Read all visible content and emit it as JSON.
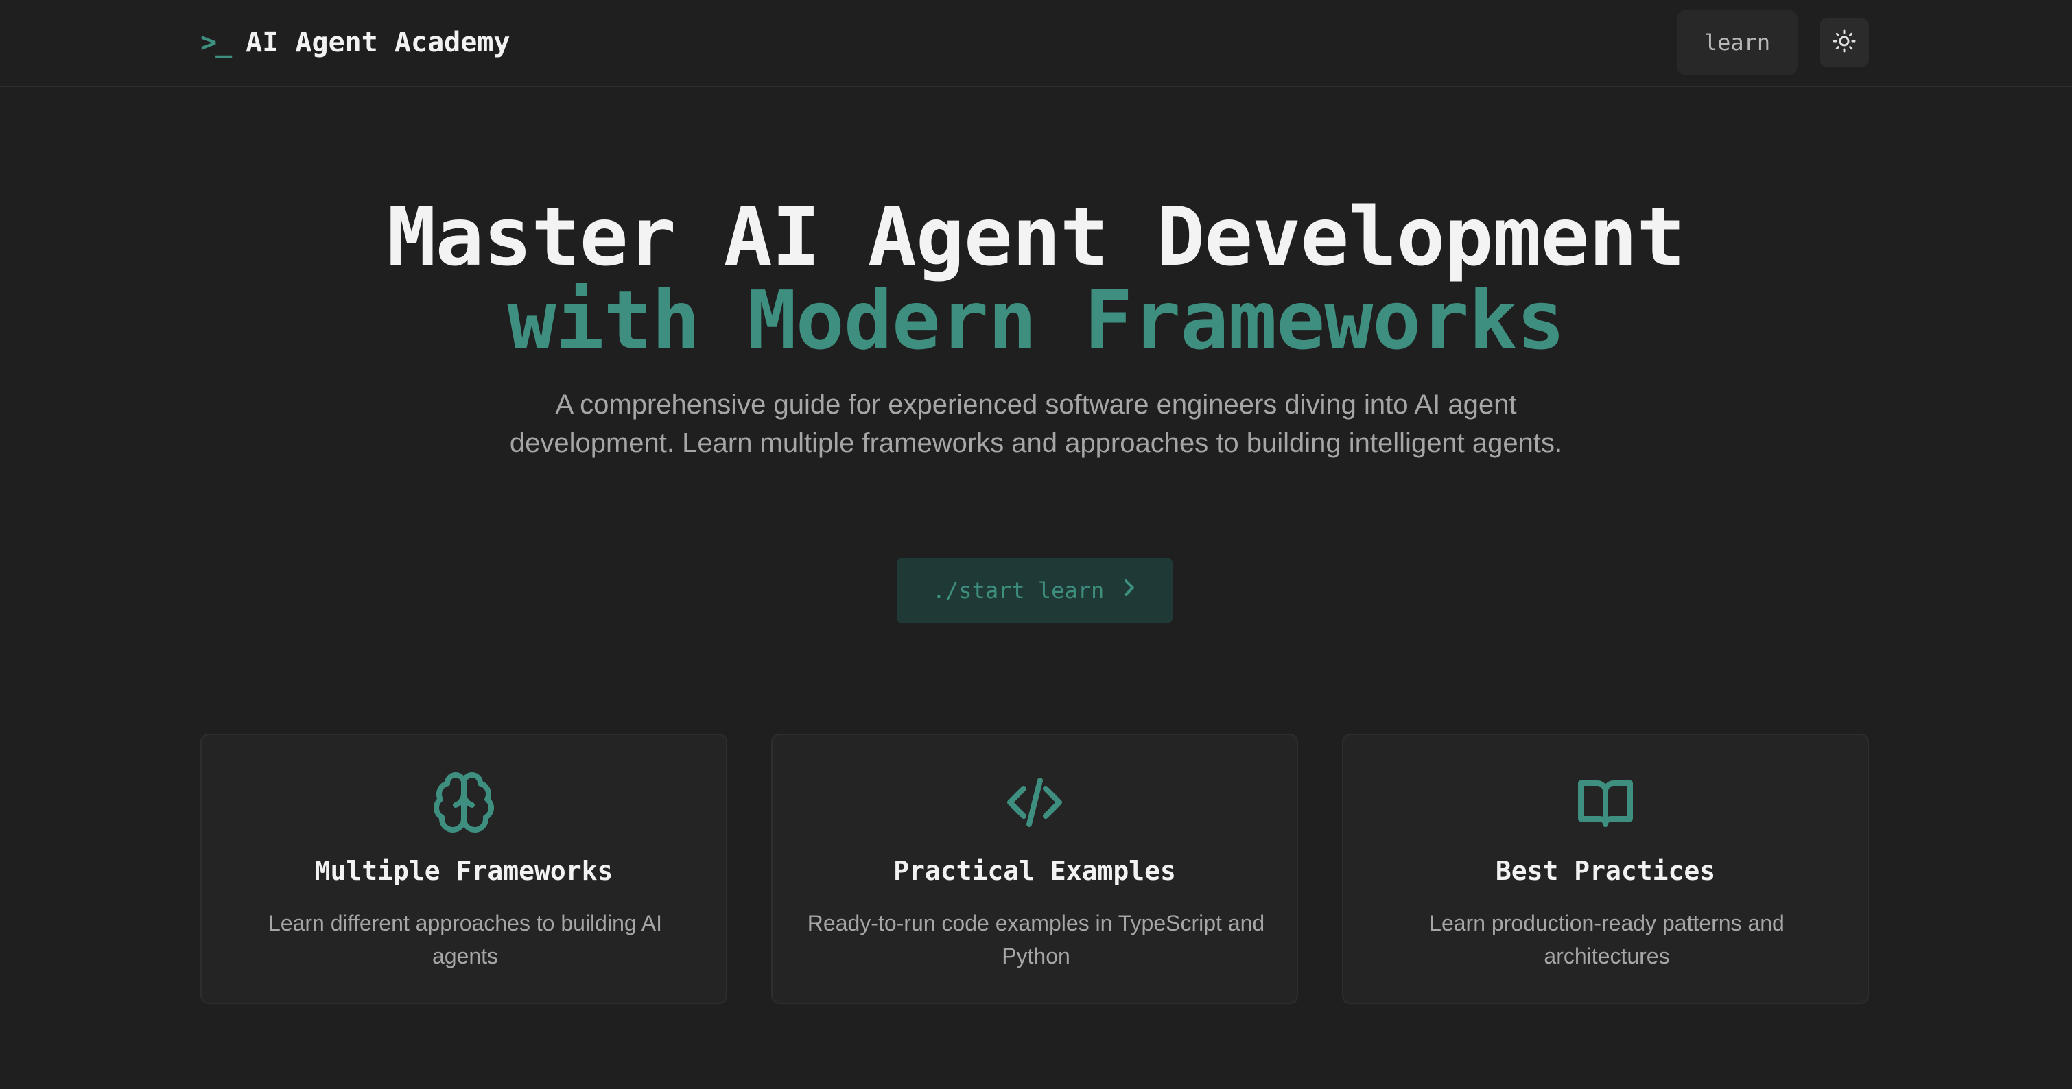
{
  "header": {
    "logo_glyph": ">_",
    "title": "AI Agent Academy",
    "nav_learn": "learn",
    "theme_toggle_icon": "sun-icon"
  },
  "hero": {
    "title_line1": "Master AI Agent Development",
    "title_line2": "with Modern Frameworks",
    "subtitle": "A comprehensive guide for experienced software engineers diving into AI agent development. Learn multiple frameworks and approaches to building intelligent agents.",
    "cta_label": "./start learn",
    "cta_icon": "chevron-right-icon"
  },
  "features": [
    {
      "icon": "brain-icon",
      "title": "Multiple Frameworks",
      "description": "Learn different approaches to building AI agents"
    },
    {
      "icon": "code-icon",
      "title": "Practical Examples",
      "description": "Ready-to-run code examples in TypeScript and Python"
    },
    {
      "icon": "book-open-icon",
      "title": "Best Practices",
      "description": "Learn production-ready patterns and architectures"
    }
  ],
  "colors": {
    "background": "#1f1f1f",
    "accent": "#3e8f80",
    "card": "#242424",
    "muted_text": "#a6a6a6"
  }
}
